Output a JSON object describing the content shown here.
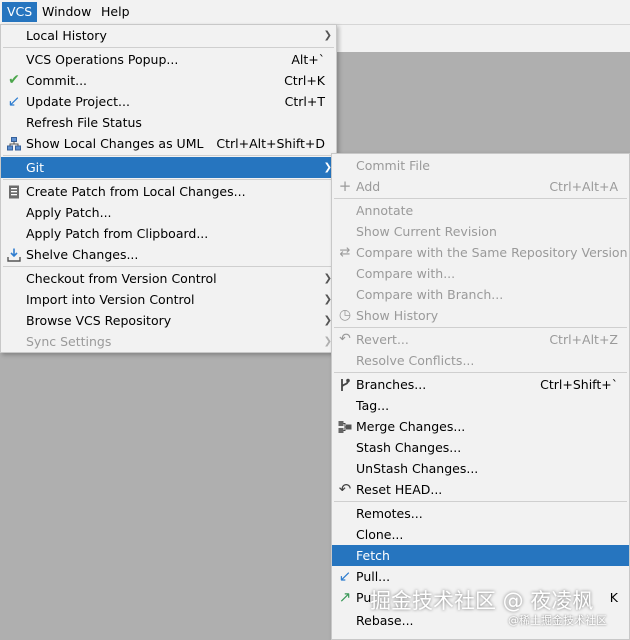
{
  "menubar": {
    "vcs": "VCS",
    "window": "Window",
    "help": "Help"
  },
  "vcs_menu": {
    "local_history": "Local History",
    "ops_popup": "VCS Operations Popup...",
    "ops_popup_sc": "Alt+`",
    "commit": "Commit...",
    "commit_sc": "Ctrl+K",
    "update_project": "Update Project...",
    "update_project_sc": "Ctrl+T",
    "refresh_status": "Refresh File Status",
    "show_uml": "Show Local Changes as UML",
    "show_uml_sc": "Ctrl+Alt+Shift+D",
    "git": "Git",
    "create_patch": "Create Patch from Local Changes...",
    "apply_patch": "Apply Patch...",
    "apply_clipboard": "Apply Patch from Clipboard...",
    "shelve": "Shelve Changes...",
    "checkout": "Checkout from Version Control",
    "import": "Import into Version Control",
    "browse": "Browse VCS Repository",
    "sync": "Sync Settings"
  },
  "git_menu": {
    "commit_file": "Commit File",
    "add": "Add",
    "add_sc": "Ctrl+Alt+A",
    "annotate": "Annotate",
    "show_revision": "Show Current Revision",
    "compare_same": "Compare with the Same Repository Version",
    "compare_with": "Compare with...",
    "compare_branch": "Compare with Branch...",
    "show_history": "Show History",
    "revert": "Revert...",
    "revert_sc": "Ctrl+Alt+Z",
    "resolve": "Resolve Conflicts...",
    "branches": "Branches...",
    "branches_sc": "Ctrl+Shift+`",
    "tag": "Tag...",
    "merge": "Merge Changes...",
    "stash": "Stash Changes...",
    "unstash": "UnStash Changes...",
    "reset_head": "Reset HEAD...",
    "remotes": "Remotes...",
    "clone": "Clone...",
    "fetch": "Fetch",
    "pull": "Pull...",
    "push": "Pu",
    "push_sc": "K",
    "rebase": "Rebase..."
  },
  "watermark": {
    "main": "掘金技术社区 @ 夜凌枫",
    "small": "@稀土掘金技术社区"
  },
  "colors": {
    "selection": "#2675bf",
    "menu_bg": "#f2f2f2",
    "disabled_text": "#9a9a9a",
    "background": "#afafaf"
  }
}
